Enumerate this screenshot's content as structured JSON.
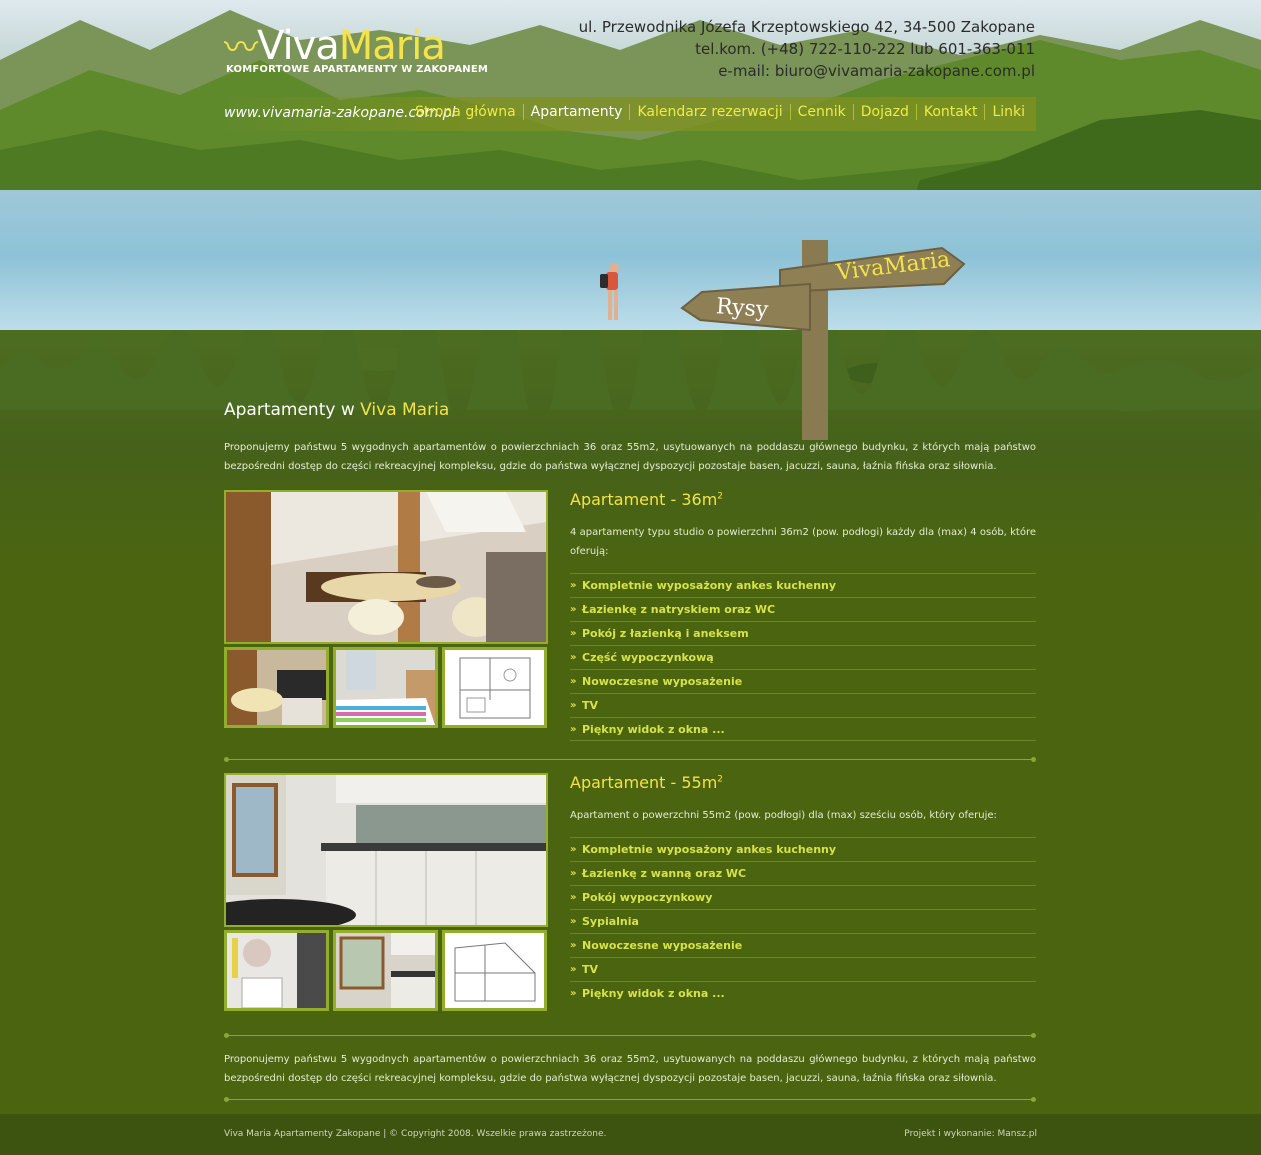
{
  "header": {
    "logo_viva": "Viva",
    "logo_maria": "Maria",
    "tagline": "KOMFORTOWE APARTAMENTY W ZAKOPANEM",
    "address": "ul. Przewodnika Józefa Krzeptowskiego 42, 34-500 Zakopane",
    "phone": "tel.kom. (+48) 722-110-222 lub 601-363-011",
    "email_label": "e-mail:",
    "email": "biuro@vivamaria-zakopane.com.pl",
    "url": "www.vivamaria-zakopane.com.pl"
  },
  "nav": {
    "items": [
      {
        "label": "Strona główna",
        "active": false
      },
      {
        "label": "Apartamenty",
        "active": true
      },
      {
        "label": "Kalendarz rezerwacji",
        "active": false
      },
      {
        "label": "Cennik",
        "active": false
      },
      {
        "label": "Dojazd",
        "active": false
      },
      {
        "label": "Kontakt",
        "active": false
      },
      {
        "label": "Linki",
        "active": false
      }
    ]
  },
  "scene": {
    "sign_top": "VivaMaria",
    "sign_bottom": "Rysy"
  },
  "content": {
    "title_prefix": "Apartamenty w ",
    "title_highlight": "Viva Maria",
    "intro": "Proponujemy państwu 5 wygodnych apartamentów o powierzchniach 36 oraz 55m2, usytuowanych na poddaszu głównego budynku, z których mają państwo bezpośredni dostęp do części rekreacyjnej kompleksu, gdzie do państwa wyłącznej dyspozycji pozostaje basen, jacuzzi, sauna, łaźnia fińska oraz siłownia."
  },
  "apartments": [
    {
      "title": "Apartament - 36m",
      "sup": "2",
      "desc": "4 apartamenty typu studio o powierzchni 36m2 (pow. podłogi) każdy dla (max) 4 osób, które oferują:",
      "features": [
        "Kompletnie wyposażony ankes kuchenny",
        "Łazienkę z natryskiem oraz WC",
        "Pokój z łazienką i aneksem",
        "Część wypoczynkową",
        "Nowoczesne wyposażenie",
        "TV",
        "Piękny widok z okna ..."
      ]
    },
    {
      "title": "Apartament - 55m",
      "sup": "2",
      "desc": "Apartament o powerzchni 55m2 (pow. podłogi) dla (max) sześciu osób, który oferuje:",
      "features": [
        "Kompletnie wyposażony ankes kuchenny",
        "Łazienkę z wanną oraz WC",
        "Pokój wypoczynkowy",
        "Sypialnia",
        "Nowoczesne wyposażenie",
        "TV",
        "Piękny widok z okna ..."
      ]
    }
  ],
  "outro": "Proponujemy państwu 5 wygodnych apartamentów o powierzchniach 36 oraz 55m2, usytuowanych na poddaszu głównego budynku, z których mają państwo bezpośredni dostęp do części rekreacyjnej kompleksu, gdzie do państwa wyłącznej dyspozycji pozostaje basen, jacuzzi, sauna, łaźnia fińska oraz siłownia.",
  "footer": {
    "left": "Viva Maria Apartamenty Zakopane | © Copyright 2008. Wszelkie prawa zastrzeżone.",
    "right": "Projekt i wykonanie: Mansz.pl"
  },
  "colors": {
    "background": "#4a6410",
    "accent_yellow": "#f4e34a",
    "feature_text": "#d8e24a",
    "footer_bg": "#3d5410"
  }
}
